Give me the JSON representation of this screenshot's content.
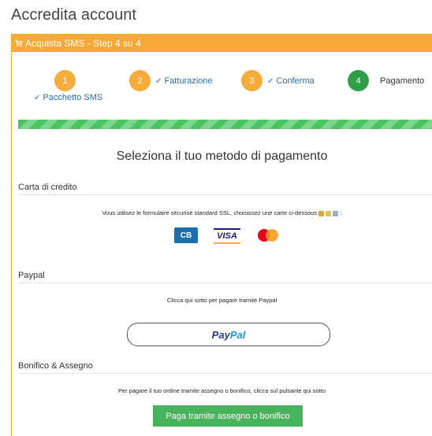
{
  "page": {
    "title": "Accredita account"
  },
  "panel": {
    "header": "Acquista SMS - Step 4 su 4"
  },
  "steps": [
    {
      "number": "1",
      "label": "Pacchetto SMS",
      "done": true
    },
    {
      "number": "2",
      "label": "Fatturazione",
      "done": true
    },
    {
      "number": "3",
      "label": "Conferma",
      "done": true
    },
    {
      "number": "4",
      "label": "Pagamento",
      "done": false
    }
  ],
  "progress": {
    "percent": 100,
    "color": "#4cc361"
  },
  "payment": {
    "title": "Seleziona il tuo metodo di pagamento",
    "credit_card": {
      "heading": "Carta di credito",
      "description": "Vous utilisez le formulaire sécurisé standard SSL, choisissez une carte ci-dessous",
      "cards": [
        "CB",
        "VISA",
        "Mastercard"
      ]
    },
    "paypal": {
      "heading": "Paypal",
      "description": "Clicca qui sotto per pagare tramite Paypal",
      "button_pay": "Pay",
      "button_pal": "Pal"
    },
    "bank": {
      "heading": "Bonifico & Assegno",
      "description": "Per pagare il tuo ordine tramite assegno o bonifico, clicca sul pulsante qui sotto",
      "button": "Paga tramite assegno o bonifico"
    }
  },
  "colors": {
    "accent": "#f7a935",
    "active_step": "#2e9e47",
    "bank_button": "#49b25c"
  }
}
